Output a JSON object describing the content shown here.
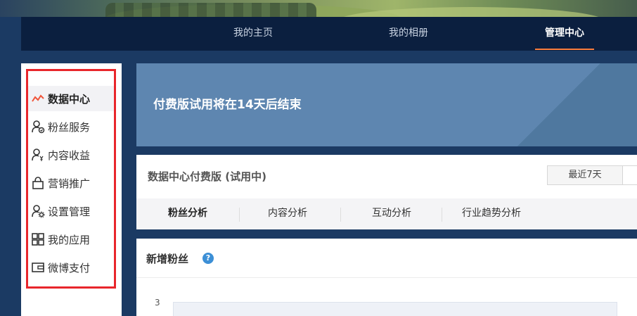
{
  "nav": {
    "items": [
      {
        "label": "我的主页"
      },
      {
        "label": "我的相册"
      },
      {
        "label": "管理中心",
        "active": true
      }
    ],
    "accent_color": "#fa7d3c"
  },
  "sidebar": {
    "highlight_color": "#e8262b",
    "items": [
      {
        "label": "数据中心",
        "icon": "trend-line-icon",
        "active": true
      },
      {
        "label": "粉丝服务",
        "icon": "user-check-icon"
      },
      {
        "label": "内容收益",
        "icon": "user-yen-icon"
      },
      {
        "label": "营销推广",
        "icon": "bag-icon"
      },
      {
        "label": "设置管理",
        "icon": "user-gear-icon"
      },
      {
        "label": "我的应用",
        "icon": "grid-icon"
      },
      {
        "label": "微博支付",
        "icon": "wallet-icon"
      }
    ]
  },
  "trial": {
    "message": "付费版试用将在14天后结束"
  },
  "panel": {
    "title": "数据中心付费版 (试用中)",
    "range_label": "最近7天",
    "tabs": [
      {
        "label": "粉丝分析",
        "active": true
      },
      {
        "label": "内容分析"
      },
      {
        "label": "互动分析"
      },
      {
        "label": "行业趋势分析"
      }
    ]
  },
  "fans_card": {
    "title": "新增粉丝",
    "help": "?",
    "y_tick": "3"
  }
}
